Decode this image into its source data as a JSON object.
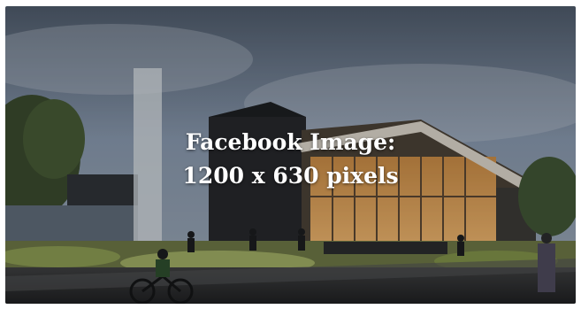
{
  "image_card": {
    "caption_line1": "Facebook Image:",
    "caption_line2": "1200 x 630 pixels",
    "overlay_color": "#000000",
    "sky_color": "#7d8ea4",
    "building_dark": "#26282b",
    "facade_light": "#e2a35a",
    "lawn_color": "#7d8a4a"
  }
}
